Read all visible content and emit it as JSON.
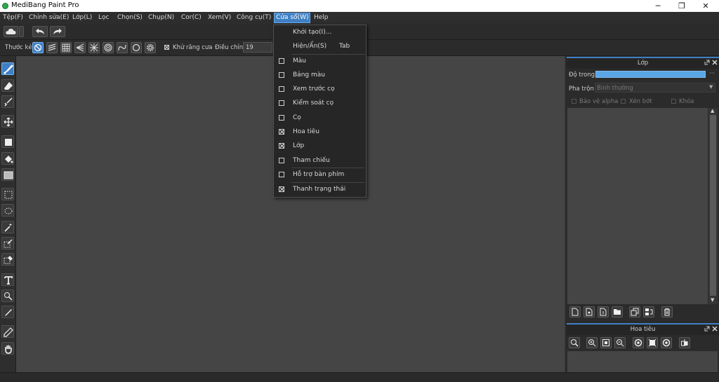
{
  "app": {
    "title": "MediBang Paint Pro"
  },
  "window_controls": {
    "minimize": "─",
    "restore": "❐",
    "close": "✕"
  },
  "menubar": {
    "items": [
      "Tệp(F)",
      "Chỉnh sửa(E)",
      "Lớp(L)",
      "Lọc",
      "Chọn(S)",
      "Chụp(N)",
      "Cor(C)",
      "Xem(V)",
      "Công cụ(T)",
      "Cửa sổ(W)",
      "Help"
    ],
    "active": "Cửa sổ(W)"
  },
  "optionsbar": {
    "ruler_label": "Thước kẻ",
    "antialias_label": "Khử răng cưa",
    "correction_label": "Điều chỉnh",
    "correction_value": "19"
  },
  "dropdown": {
    "items": [
      {
        "label": "Khởi tạo(I)...",
        "shortcut": "",
        "checkbox": false,
        "checked": false
      },
      {
        "label": "Hiện/Ẩn(S)",
        "shortcut": "Tab",
        "checkbox": false,
        "checked": false
      },
      {
        "label": "Màu",
        "checkbox": true,
        "checked": false
      },
      {
        "label": "Bảng màu",
        "checkbox": true,
        "checked": false
      },
      {
        "label": "Xem trước cọ",
        "checkbox": true,
        "checked": false
      },
      {
        "label": "Kiểm soát cọ",
        "checkbox": true,
        "checked": false
      },
      {
        "label": "Cọ",
        "checkbox": true,
        "checked": false
      },
      {
        "label": "Hoa tiêu",
        "checkbox": true,
        "checked": true
      },
      {
        "label": "Lớp",
        "checkbox": true,
        "checked": true
      },
      {
        "label": "Tham chiếu",
        "checkbox": true,
        "checked": false
      },
      {
        "label": "Hỗ trợ bàn phím",
        "checkbox": true,
        "checked": false
      },
      {
        "label": "Thanh trạng thái",
        "checkbox": true,
        "checked": true
      }
    ]
  },
  "layer_panel": {
    "title": "Lớp",
    "opacity_label": "Độ trong",
    "blend_label": "Pha trộn",
    "blend_value": "Bình thường",
    "protect_alpha": "Bảo vệ alpha",
    "clipping": "Xén bớt",
    "lock": "Khóa"
  },
  "navigator_panel": {
    "title": "Hoa tiêu"
  },
  "colors": {
    "accent": "#3f7fc4",
    "opacity_bar": "#5aa6e6",
    "canvas": "#454545"
  }
}
